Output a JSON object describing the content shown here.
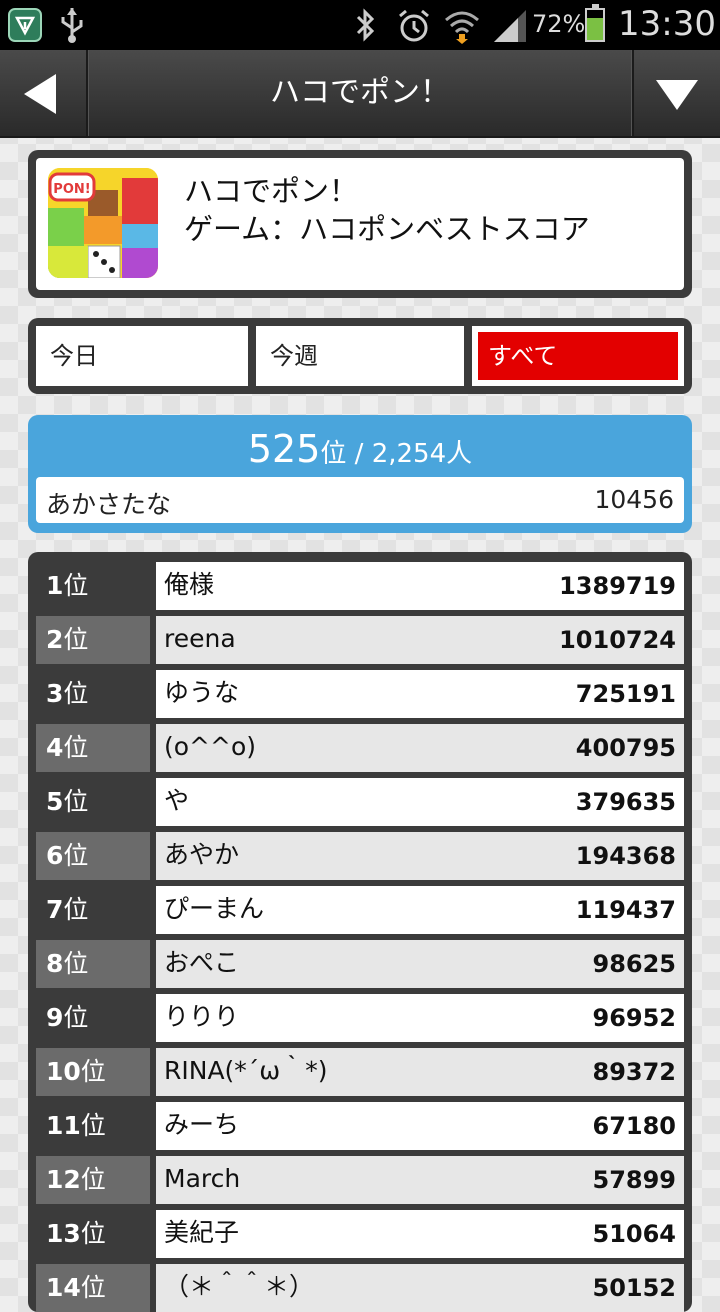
{
  "status_bar": {
    "battery_percent": "72%",
    "time": "13:30"
  },
  "title_bar": {
    "title": "ハコでポン！"
  },
  "game": {
    "name": "ハコでポン！",
    "subtitle": "ゲーム：ハコポンベストスコア",
    "icon_text": "PON!"
  },
  "tabs": [
    {
      "label": "今日",
      "active": false
    },
    {
      "label": "今週",
      "active": false
    },
    {
      "label": "すべて",
      "active": true
    }
  ],
  "my_rank": {
    "rank": "525",
    "rank_unit": "位",
    "separator": " / ",
    "total": "2,254",
    "total_unit": "人",
    "user_name": "あかさたな",
    "score": "10456"
  },
  "leaderboard": [
    {
      "rank": "1",
      "name": "俺様",
      "score": "1389719"
    },
    {
      "rank": "2",
      "name": "reena",
      "score": "1010724"
    },
    {
      "rank": "3",
      "name": "ゆうな",
      "score": "725191"
    },
    {
      "rank": "4",
      "name": "(o^^o)",
      "score": "400795"
    },
    {
      "rank": "5",
      "name": "や",
      "score": "379635"
    },
    {
      "rank": "6",
      "name": "あやか",
      "score": "194368"
    },
    {
      "rank": "7",
      "name": "ぴーまん",
      "score": "119437"
    },
    {
      "rank": "8",
      "name": "おぺこ",
      "score": "98625"
    },
    {
      "rank": "9",
      "name": "りりり",
      "score": "96952"
    },
    {
      "rank": "10",
      "name": "RINA(*´ω｀*)",
      "score": "89372"
    },
    {
      "rank": "11",
      "name": "みーち",
      "score": "67180"
    },
    {
      "rank": "12",
      "name": "March",
      "score": "57899"
    },
    {
      "rank": "13",
      "name": "美紀子",
      "score": "51064"
    },
    {
      "rank": "14",
      "name": "（＊＾＾＊）",
      "score": "50152"
    }
  ],
  "rank_suffix": "位",
  "colors": {
    "accent_red": "#e30000",
    "rank_blue": "#4aa5dc",
    "dark_panel": "#3b3b3b"
  }
}
